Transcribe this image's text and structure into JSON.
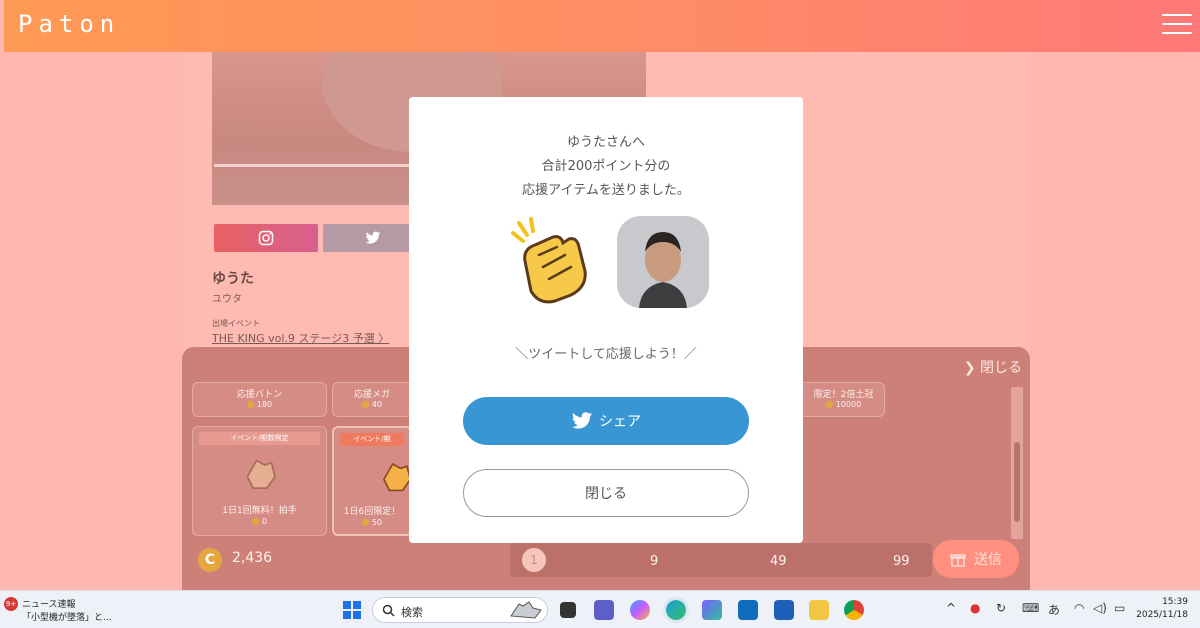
{
  "app": {
    "logo": "Paton",
    "profile": {
      "name": "ゆうた",
      "kana": "ユウタ",
      "event_label": "出場イベント",
      "event_link": "THE KING vol.9 ステージ3 予選 〉"
    },
    "panel": {
      "close_label": "❯ 閉じる",
      "items": [
        {
          "title": "応援バトン",
          "price": "180"
        },
        {
          "title": "応援メガ",
          "price": "40"
        },
        {
          "title": "限定！2倍土冠",
          "price": "10000"
        },
        {
          "tag": "イベント/期数限定",
          "title": "1日1回無料！拍手",
          "price": "0"
        },
        {
          "tag": "イベント/期",
          "title": "1日6回限定！",
          "price": "50"
        }
      ],
      "balance": "2,436",
      "coin_symbol": "C",
      "quantities": [
        "1",
        "9",
        "49",
        "99"
      ],
      "send_label": "送信"
    }
  },
  "modal": {
    "line1": "ゆうたさんへ",
    "line2": "合計200ポイント分の",
    "line3": "応援アイテムを送りました。",
    "tweet_call": "＼ツイートして応援しよう！／",
    "share_label": "シェア",
    "close_label": "閉じる"
  },
  "taskbar": {
    "news_badge": "9+",
    "news_title": "ニュース速報",
    "news_sub": "「小型機が墜落」と...",
    "search_placeholder": "検索",
    "ime": "あ",
    "time": "15:39",
    "date": "2025/11/18"
  },
  "colors": {
    "header_start": "#ff9a54",
    "header_end": "#ff7878",
    "overlay": "#ffb8b0",
    "twitter": "#3896d4"
  }
}
